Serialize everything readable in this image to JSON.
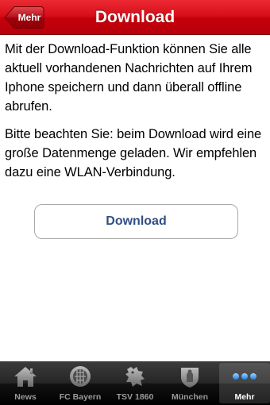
{
  "navbar": {
    "title": "Download",
    "back_label": "Mehr"
  },
  "content": {
    "paragraphs": [
      "Mit der Download-Funktion können Sie alle aktuell vorhandenen Nachrichten auf Ihrem Iphone speichern und dann überall offline abrufen.",
      "Bitte beachten Sie: beim Download wird eine große Datenmenge geladen. Wir empfehlen dazu eine WLAN-Verbindung."
    ],
    "download_button": "Download"
  },
  "tabbar": {
    "tabs": [
      {
        "label": "News",
        "icon": "house-icon",
        "active": false
      },
      {
        "label": "FC Bayern",
        "icon": "fc-bayern-crest-icon",
        "active": false
      },
      {
        "label": "TSV 1860",
        "icon": "lion-crest-icon",
        "active": false
      },
      {
        "label": "München",
        "icon": "munich-crest-icon",
        "active": false
      },
      {
        "label": "Mehr",
        "icon": "more-dots-icon",
        "active": true
      }
    ]
  },
  "colors": {
    "navbar": "#d50b16",
    "button_text": "#324f85",
    "tabbar": "#1a1a1a",
    "tab_active_icon": "#5aa9ff"
  }
}
